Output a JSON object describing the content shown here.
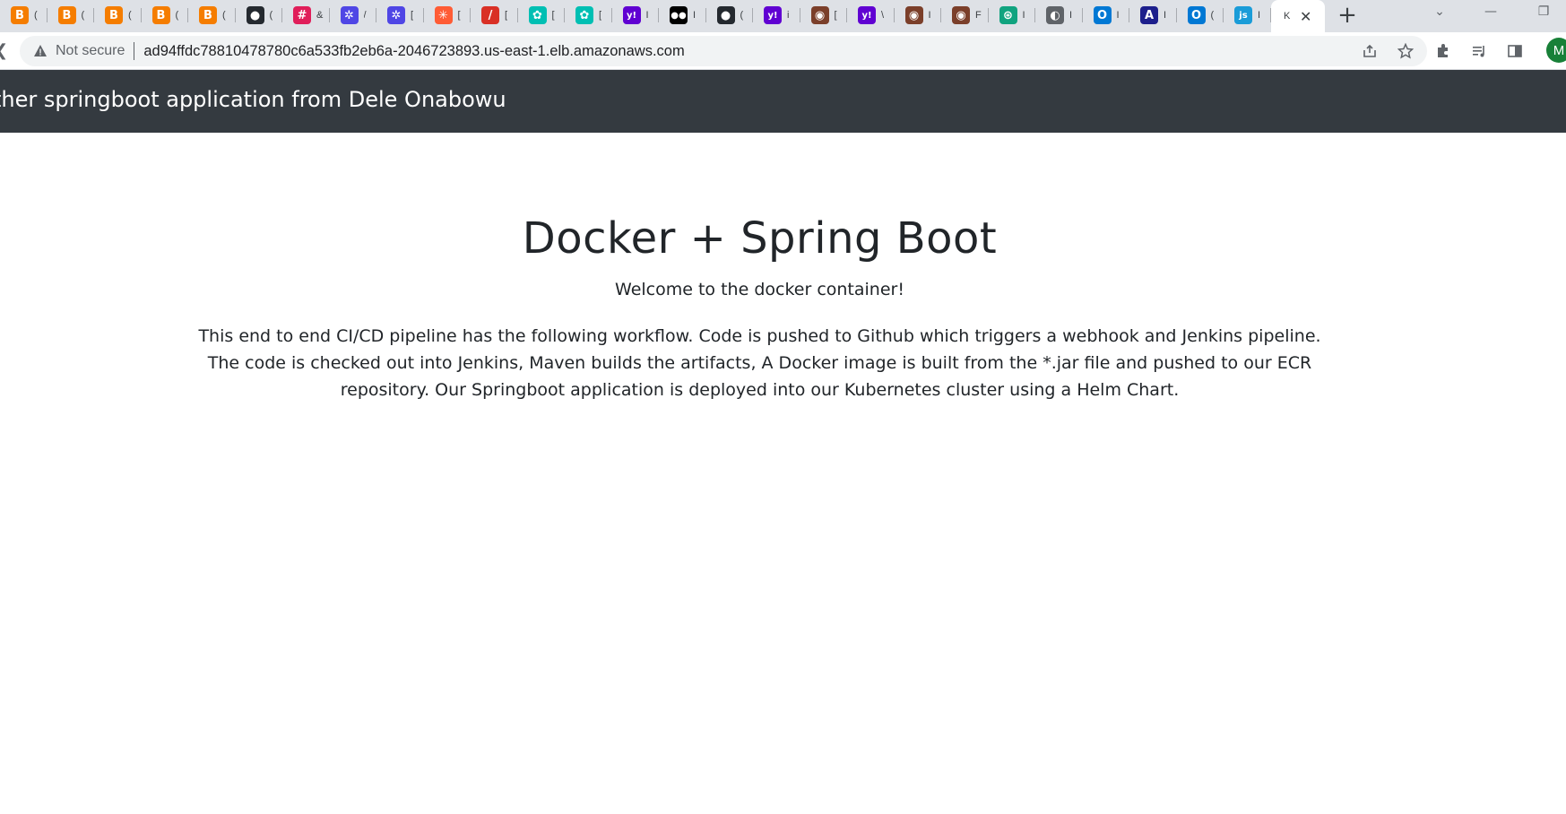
{
  "browser": {
    "tabs": [
      {
        "icon": "blogger-icon",
        "color": "#f57d00",
        "glyph": "B",
        "label": "("
      },
      {
        "icon": "blogger-icon",
        "color": "#f57d00",
        "glyph": "B",
        "label": "("
      },
      {
        "icon": "blogger-icon",
        "color": "#f57d00",
        "glyph": "B",
        "label": "("
      },
      {
        "icon": "blogger-icon",
        "color": "#f57d00",
        "glyph": "B",
        "label": "("
      },
      {
        "icon": "blogger-icon",
        "color": "#f57d00",
        "glyph": "B",
        "label": "("
      },
      {
        "icon": "github-icon",
        "color": "#24292f",
        "glyph": "●",
        "label": "("
      },
      {
        "icon": "slack-icon",
        "color": "#e01e5a",
        "glyph": "#",
        "label": "&"
      },
      {
        "icon": "asterisk-icon",
        "color": "#4f46e5",
        "glyph": "✲",
        "label": "/"
      },
      {
        "icon": "asterisk-icon",
        "color": "#4f46e5",
        "glyph": "✲",
        "label": "["
      },
      {
        "icon": "hubspot-icon",
        "color": "#ff5c35",
        "glyph": "✳",
        "label": "["
      },
      {
        "icon": "pen-icon",
        "color": "#d93025",
        "glyph": "/",
        "label": "["
      },
      {
        "icon": "elastic-icon",
        "color": "#00bfb3",
        "glyph": "✿",
        "label": "["
      },
      {
        "icon": "elastic-icon",
        "color": "#00bfb3",
        "glyph": "✿",
        "label": "["
      },
      {
        "icon": "yahoo-icon",
        "color": "#6001d2",
        "glyph": "y!",
        "label": "I"
      },
      {
        "icon": "medium-icon",
        "color": "#000000",
        "glyph": "●●",
        "label": "I"
      },
      {
        "icon": "github-icon",
        "color": "#24292f",
        "glyph": "●",
        "label": "("
      },
      {
        "icon": "yahoo-icon",
        "color": "#6001d2",
        "glyph": "y!",
        "label": "i"
      },
      {
        "icon": "profile-icon",
        "color": "#7b3f2a",
        "glyph": "◉",
        "label": "["
      },
      {
        "icon": "yahoo-icon",
        "color": "#6001d2",
        "glyph": "y!",
        "label": "\\"
      },
      {
        "icon": "profile-icon",
        "color": "#7b3f2a",
        "glyph": "◉",
        "label": "I"
      },
      {
        "icon": "profile-icon",
        "color": "#7b3f2a",
        "glyph": "◉",
        "label": "F"
      },
      {
        "icon": "chatgpt-icon",
        "color": "#10a37f",
        "glyph": "⊛",
        "label": "I"
      },
      {
        "icon": "globe-icon",
        "color": "#5f6368",
        "glyph": "◐",
        "label": "I"
      },
      {
        "icon": "outlook-icon",
        "color": "#0078d4",
        "glyph": "O",
        "label": "I"
      },
      {
        "icon": "a-logo-icon",
        "color": "#1d1f8c",
        "glyph": "A",
        "label": "I"
      },
      {
        "icon": "outlook-icon",
        "color": "#0078d4",
        "glyph": "O",
        "label": "("
      },
      {
        "icon": "js-icon",
        "color": "#1a9cd8",
        "glyph": "js",
        "label": "I"
      }
    ],
    "active_tab_label": "K",
    "not_secure_label": "Not secure",
    "url": "ad94ffdc78810478780c6a533fb2eb6a-2046723893.us-east-1.elb.amazonaws.com",
    "avatar_letter": "M"
  },
  "page": {
    "navbar_brand": "ther springboot application from Dele Onabowu",
    "title": "Docker + Spring Boot",
    "subtitle": "Welcome to the docker container!",
    "description": "This end to end CI/CD pipeline has the following workflow. Code is pushed to Github which triggers a webhook and Jenkins pipeline. The code is checked out into Jenkins, Maven builds the artifacts, A Docker image is built from the *.jar file and pushed to our ECR repository. Our Springboot application is deployed into our Kubernetes cluster using a Helm Chart."
  }
}
